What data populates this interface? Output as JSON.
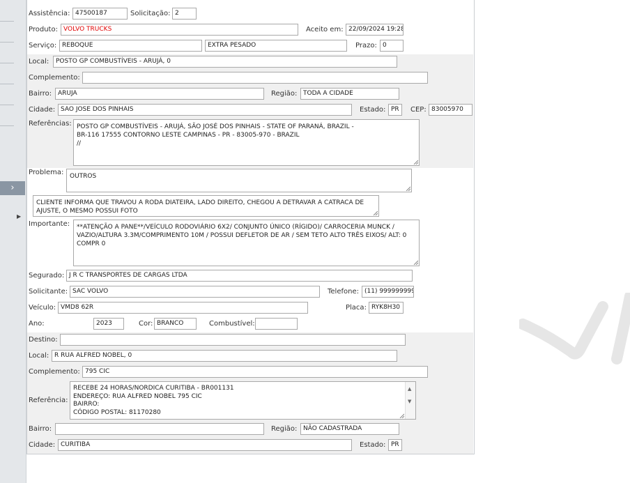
{
  "assistencia": {
    "label": "Assistência:",
    "value": "47500187"
  },
  "solicitacao": {
    "label": "Solicitação:",
    "value": "2"
  },
  "produto": {
    "label": "Produto:",
    "value": "VOLVO TRUCKS"
  },
  "aceito_em": {
    "label": "Aceito em:",
    "value": "22/09/2024 19:28"
  },
  "servico": {
    "label": "Serviço:",
    "value": "REBOQUE",
    "value2": "EXTRA PESADO"
  },
  "prazo": {
    "label": "Prazo:",
    "value": "0"
  },
  "origem": {
    "local": {
      "label": "Local:",
      "value": "POSTO GP COMBUSTÍVEIS - ARUJÁ, 0"
    },
    "complemento": {
      "label": "Complemento:",
      "value": ""
    },
    "bairro": {
      "label": "Bairro:",
      "value": "ARUJA"
    },
    "regiao": {
      "label": "Região:",
      "value": "TODA A CIDADE"
    },
    "cidade": {
      "label": "Cidade:",
      "value": "SAO JOSE DOS PINHAIS"
    },
    "estado": {
      "label": "Estado:",
      "value": "PR"
    },
    "cep": {
      "label": "CEP:",
      "value": "83005970"
    },
    "referencias": {
      "label": "Referências:",
      "lines": [
        "POSTO GP COMBUSTÍVEIS - ARUJÁ, SÃO JOSÉ DOS PINHAIS - STATE OF PARANÁ, BRAZIL -",
        "BR-116 17555 CONTORNO LESTE CAMPINAS - PR - 83005-970 - BRAZIL",
        "//"
      ]
    }
  },
  "problema": {
    "label": "Problema:",
    "value": "OUTROS"
  },
  "descricao": {
    "lines": [
      "CLIENTE INFORMA QUE TRAVOU A RODA DIATEIRA, LADO DIREITO, CHEGOU A DETRAVAR A CATRACA DE",
      "AJUSTE, O MESMO POSSUI FOTO"
    ]
  },
  "importante": {
    "label": "Importante:",
    "lines": [
      "**ATENÇÃO A PANE**/VEÍCULO RODOVIÁRIO 6X2/ CONJUNTO ÚNICO (RÍGIDO)/ CARROCERIA MUNCK /",
      "VAZIO/ALTURA 3.3M/COMPRIMENTO 10M / POSSUI DEFLETOR DE AR / SEM TETO ALTO TRÊS EIXOS/ ALT: 0",
      "COMPR 0"
    ]
  },
  "segurado": {
    "label": "Segurado:",
    "value": "J R C TRANSPORTES DE  CARGAS LTDA"
  },
  "solicitante": {
    "label": "Solicitante:",
    "value": "SAC VOLVO"
  },
  "telefone": {
    "label": "Telefone:",
    "value": "(11) 999999999"
  },
  "veiculo": {
    "label": "Veículo:",
    "value": "VMD8 62R"
  },
  "placa": {
    "label": "Placa:",
    "value": "RYK8H30"
  },
  "ano": {
    "label": "Ano:",
    "value": "2023"
  },
  "cor": {
    "label": "Cor:",
    "value": "BRANCO"
  },
  "combustivel": {
    "label": "Combustível:",
    "value": ""
  },
  "destino": {
    "destino": {
      "label": "Destino:",
      "value": ""
    },
    "local": {
      "label": "Local:",
      "value": "R RUA ALFRED NOBEL, 0"
    },
    "complemento": {
      "label": "Complemento:",
      "value": "795 CIC"
    },
    "referencia": {
      "label": "Referência:",
      "lines": [
        "RECEBE 24 HORAS/NORDICA CURITIBA - BR001131",
        "ENDEREÇO: RUA ALFRED NOBEL 795 CIC",
        "BAIRRO:",
        "CÓDIGO POSTAL: 81170280"
      ]
    },
    "bairro": {
      "label": "Bairro:",
      "value": ""
    },
    "regiao": {
      "label": "Região:",
      "value": "NÃO CADASTRADA"
    },
    "cidade": {
      "label": "Cidade:",
      "value": "CURITIBA"
    },
    "estado": {
      "label": "Estado:",
      "value": "PR"
    }
  },
  "icons": {
    "sidebar_toggle": "chevron-right-icon",
    "sidebar_arrow": "caret-right-icon",
    "scroll_up": "caret-up-icon",
    "scroll_down": "caret-down-icon",
    "resize": "resize-grip-icon",
    "watermark": "logo-watermark"
  },
  "colors": {
    "required_text": "#e00000",
    "band": "#f0f0f0",
    "sidebar_toggle": "#8a96a3"
  }
}
